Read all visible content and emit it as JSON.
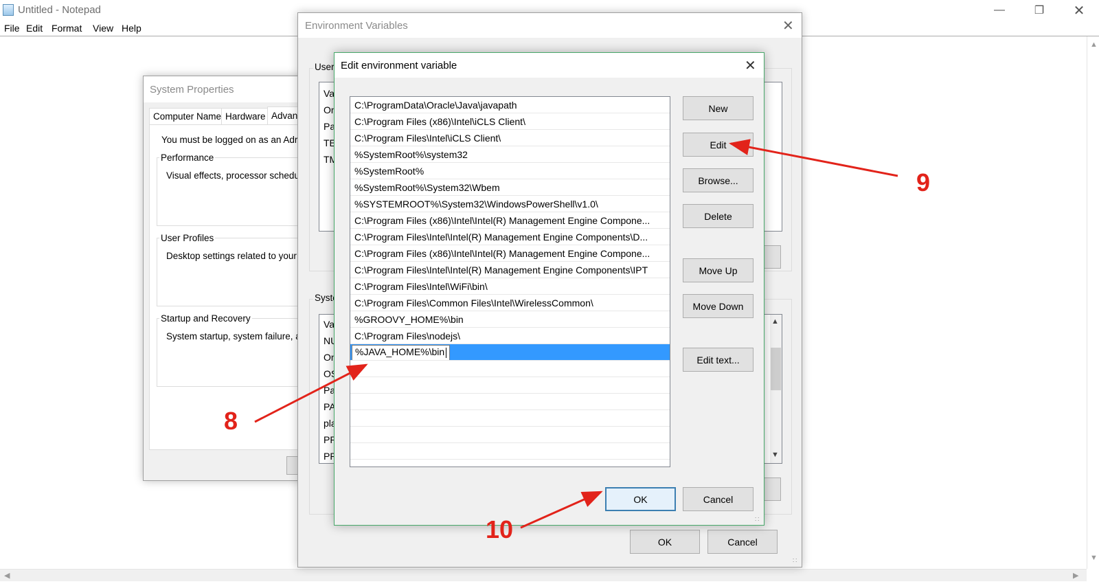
{
  "notepad": {
    "title": "Untitled - Notepad",
    "menu": [
      "File",
      "Edit",
      "Format",
      "View",
      "Help"
    ]
  },
  "system_properties": {
    "title": "System Properties",
    "tabs": [
      "Computer Name",
      "Hardware",
      "Advan"
    ],
    "admin_note": "You must be logged on as an Adr",
    "groups": [
      {
        "label": "Performance",
        "text": "Visual effects, processor schedu"
      },
      {
        "label": "User Profiles",
        "text": "Desktop settings related to your"
      },
      {
        "label": "Startup and Recovery",
        "text": "System startup, system failure, a"
      }
    ]
  },
  "env_vars": {
    "title": "Environment Variables",
    "user_label": "User",
    "user_rows": [
      "Var",
      "On",
      "Pat",
      "TEI",
      "TM"
    ],
    "system_label": "Syste",
    "system_rows": [
      "Var",
      "NU",
      "On",
      "OS",
      "Pat",
      "PA",
      "pla",
      "PR",
      "PR"
    ],
    "ok_label": "OK",
    "cancel_label": "Cancel"
  },
  "edit_env": {
    "title": "Edit environment variable",
    "paths": [
      "C:\\ProgramData\\Oracle\\Java\\javapath",
      "C:\\Program Files (x86)\\Intel\\iCLS Client\\",
      "C:\\Program Files\\Intel\\iCLS Client\\",
      "%SystemRoot%\\system32",
      "%SystemRoot%",
      "%SystemRoot%\\System32\\Wbem",
      "%SYSTEMROOT%\\System32\\WindowsPowerShell\\v1.0\\",
      "C:\\Program Files (x86)\\Intel\\Intel(R) Management Engine Compone...",
      "C:\\Program Files\\Intel\\Intel(R) Management Engine Components\\D...",
      "C:\\Program Files (x86)\\Intel\\Intel(R) Management Engine Compone...",
      "C:\\Program Files\\Intel\\Intel(R) Management Engine Components\\IPT",
      "C:\\Program Files\\Intel\\WiFi\\bin\\",
      "C:\\Program Files\\Common Files\\Intel\\WirelessCommon\\",
      "%GROOVY_HOME%\\bin",
      "C:\\Program Files\\nodejs\\"
    ],
    "editing_value": "%JAVA_HOME%\\bin",
    "buttons": {
      "new": "New",
      "edit": "Edit",
      "browse": "Browse...",
      "delete": "Delete",
      "move_up": "Move Up",
      "move_down": "Move Down",
      "edit_text": "Edit text...",
      "ok": "OK",
      "cancel": "Cancel"
    }
  },
  "annotations": {
    "step8": "8",
    "step9": "9",
    "step10": "10",
    "color": "#e2231a"
  }
}
